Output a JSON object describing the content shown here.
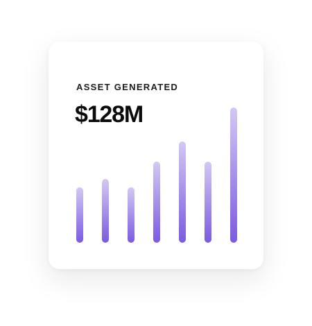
{
  "card": {
    "label": "ASSET GENERATED",
    "value": "$128M"
  },
  "chart_data": {
    "type": "bar",
    "categories": [
      "",
      "",
      "",
      "",
      "",
      "",
      ""
    ],
    "values": [
      80,
      92,
      80,
      117,
      146,
      117,
      195
    ],
    "ylim": [
      0,
      200
    ],
    "grid": false,
    "legend": "none"
  },
  "colors": {
    "bar_bottom": "#7b5ae0",
    "bar_top": "#d3c8f3",
    "text": "#111111",
    "card_bg": "#ffffff"
  }
}
